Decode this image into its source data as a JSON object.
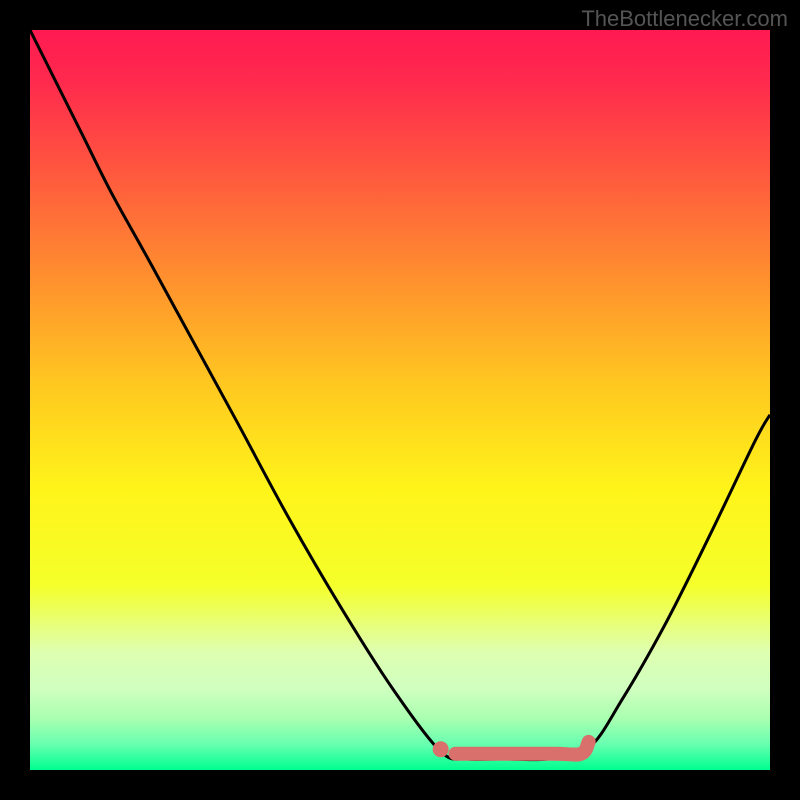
{
  "watermark": "TheBottlenecker.com",
  "chart_data": {
    "type": "line",
    "title": "",
    "xlabel": "",
    "ylabel": "",
    "xlim": [
      0,
      1
    ],
    "ylim": [
      0,
      1
    ],
    "background_gradient_stops": [
      {
        "offset": 0,
        "color": "#ff1a52"
      },
      {
        "offset": 0.07,
        "color": "#ff2a4d"
      },
      {
        "offset": 0.18,
        "color": "#ff5340"
      },
      {
        "offset": 0.32,
        "color": "#ff8a30"
      },
      {
        "offset": 0.48,
        "color": "#ffc820"
      },
      {
        "offset": 0.62,
        "color": "#fff41a"
      },
      {
        "offset": 0.75,
        "color": "#f5ff2a"
      },
      {
        "offset": 0.84,
        "color": "#deffb0"
      },
      {
        "offset": 0.89,
        "color": "#d0ffc0"
      },
      {
        "offset": 0.93,
        "color": "#aaffb0"
      },
      {
        "offset": 0.965,
        "color": "#68ffb0"
      },
      {
        "offset": 1.0,
        "color": "#00ff90"
      }
    ],
    "series": [
      {
        "name": "bottleneck-curve",
        "color": "#000000",
        "stroke_width": 3,
        "x": [
          0.0,
          0.03,
          0.07,
          0.11,
          0.16,
          0.22,
          0.28,
          0.35,
          0.42,
          0.49,
          0.555,
          0.59,
          0.64,
          0.7,
          0.755,
          0.8,
          0.86,
          0.92,
          0.98,
          1.0
        ],
        "y": [
          1.0,
          0.94,
          0.86,
          0.78,
          0.69,
          0.58,
          0.47,
          0.34,
          0.22,
          0.11,
          0.025,
          0.015,
          0.015,
          0.015,
          0.03,
          0.095,
          0.2,
          0.32,
          0.445,
          0.48
        ]
      },
      {
        "name": "highlight-segment",
        "color": "#d9706b",
        "stroke_width": 14,
        "linecap": "round",
        "x": [
          0.575,
          0.61,
          0.66,
          0.71,
          0.745,
          0.755
        ],
        "y": [
          0.022,
          0.022,
          0.022,
          0.022,
          0.022,
          0.038
        ]
      },
      {
        "name": "highlight-dot",
        "type": "scatter",
        "color": "#d9706b",
        "radius": 8,
        "x": [
          0.555
        ],
        "y": [
          0.028
        ]
      }
    ]
  }
}
